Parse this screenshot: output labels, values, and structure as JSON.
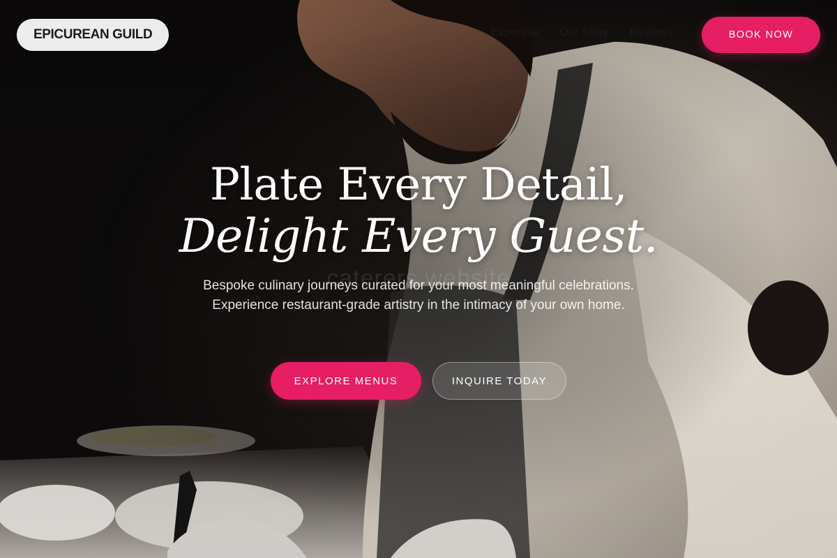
{
  "brand": {
    "name": "EPICUREAN GUILD"
  },
  "nav": {
    "items": [
      {
        "label": "Expertise"
      },
      {
        "label": "Our Story"
      },
      {
        "label": "Reviews"
      }
    ],
    "cta_label": "BOOK NOW"
  },
  "hero": {
    "headline_line1": "Plate Every Detail,",
    "headline_line2": "Delight Every Guest.",
    "watermark": "caterers website",
    "subtitle": "Bespoke culinary journeys curated for your most meaningful celebrations. Experience restaurant-grade artistry in the intimacy of your own home.",
    "primary_cta": "EXPLORE MENUS",
    "secondary_cta": "INQUIRE TODAY"
  },
  "colors": {
    "accent": "#e61e63",
    "brand_pill_bg": "#ececec",
    "background": "#0c0a0a"
  }
}
